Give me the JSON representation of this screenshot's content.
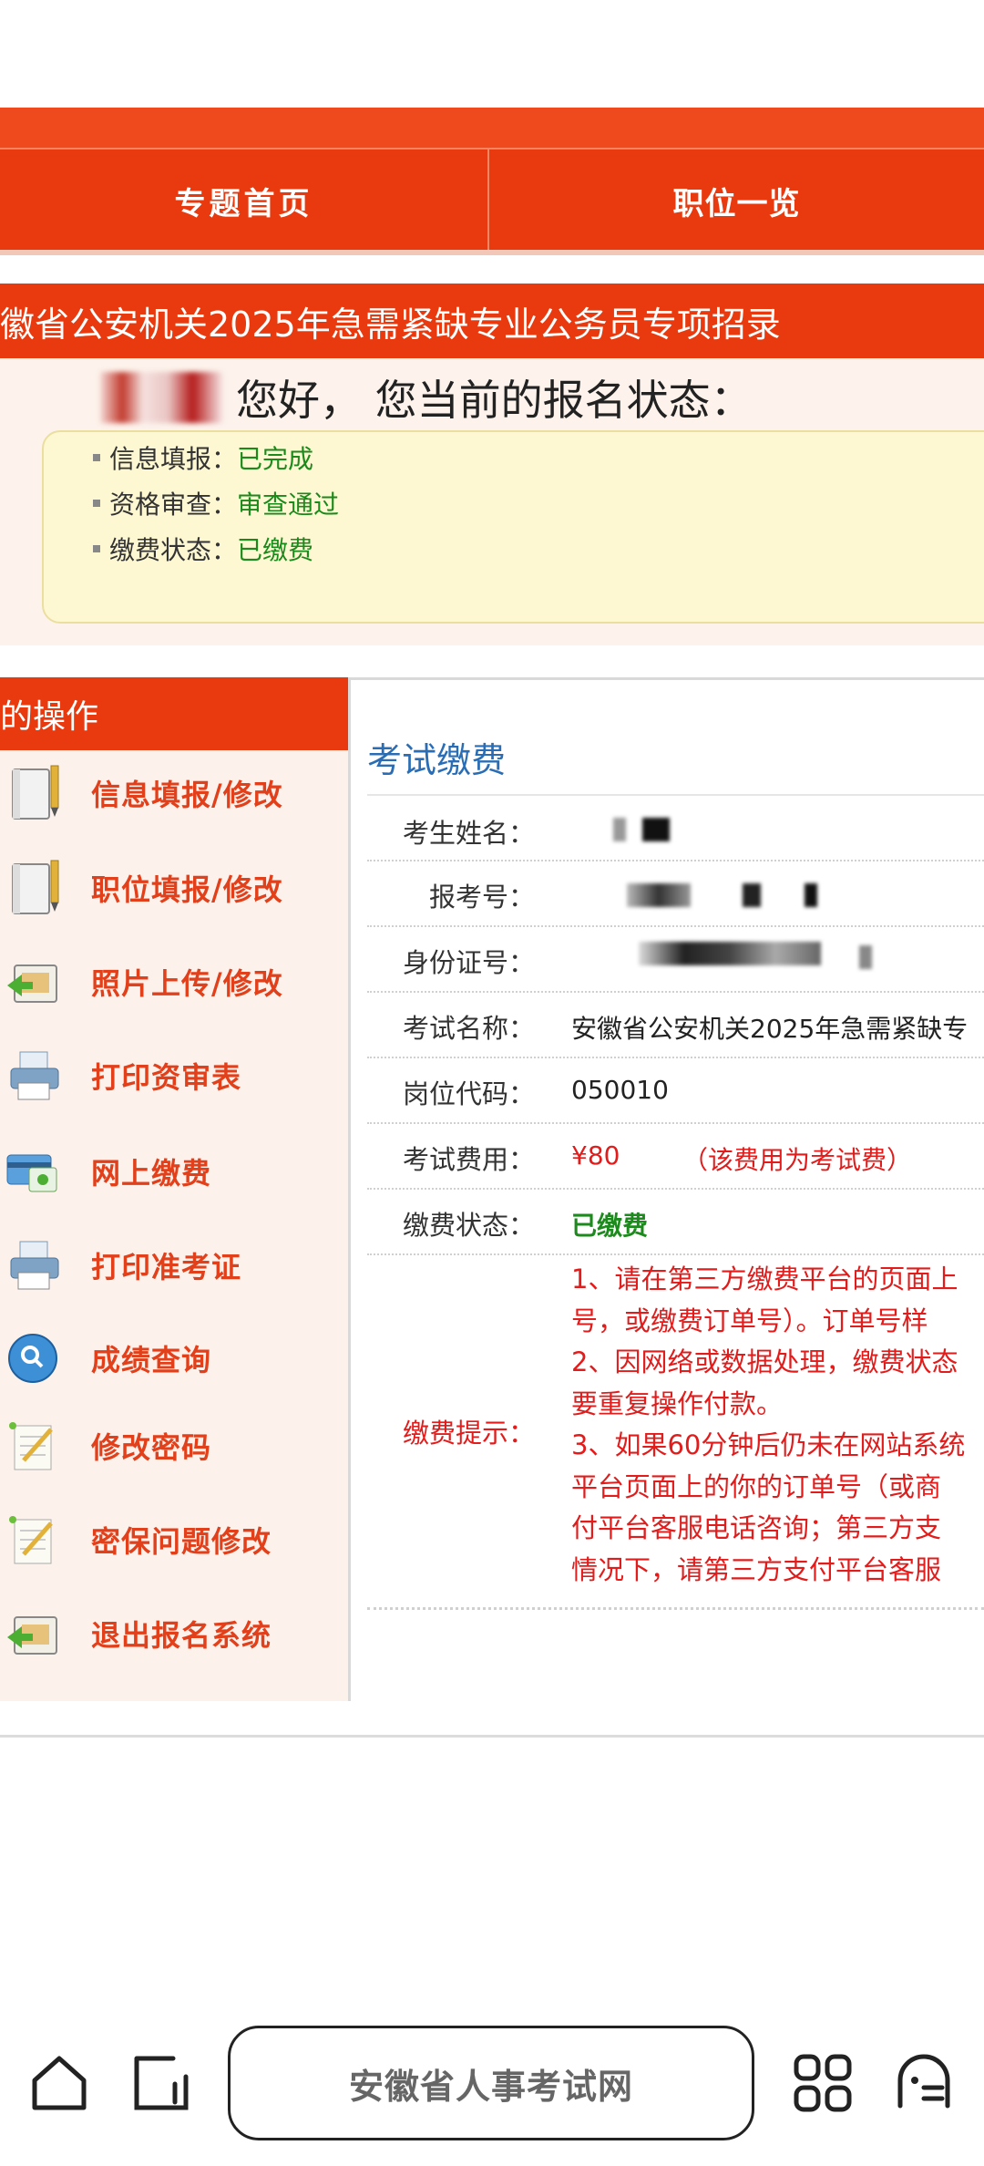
{
  "nav": {
    "home_label": "专题首页",
    "positions_label": "职位一览"
  },
  "banner": {
    "title": "徽省公安机关2025年急需紧缺专业公务员专项招录",
    "greeting": "您好， 您当前的报名状态："
  },
  "status": [
    {
      "label": "信息填报：",
      "value": "已完成"
    },
    {
      "label": "资格审查：",
      "value": "审查通过"
    },
    {
      "label": "缴费状态：",
      "value": "已缴费"
    }
  ],
  "sidebar": {
    "heading": "的操作",
    "items": [
      {
        "label": "信息填报/修改",
        "icon": "notebook-pencil-icon"
      },
      {
        "label": "职位填报/修改",
        "icon": "notebook-pencil-icon"
      },
      {
        "label": "照片上传/修改",
        "icon": "upload-arrow-icon"
      },
      {
        "label": "打印资审表",
        "icon": "printer-icon"
      },
      {
        "label": "网上缴费",
        "icon": "payment-card-icon"
      },
      {
        "label": "打印准考证",
        "icon": "printer-icon"
      },
      {
        "label": "成绩查询",
        "icon": "magnifier-icon"
      },
      {
        "label": "修改密码",
        "icon": "edit-note-icon"
      },
      {
        "label": "密保问题修改",
        "icon": "edit-note-icon"
      },
      {
        "label": "退出报名系统",
        "icon": "exit-arrow-icon"
      }
    ]
  },
  "content": {
    "title": "考试缴费",
    "fields": {
      "name_label": "考生姓名：",
      "regno_label": "报考号：",
      "id_label": "身份证号：",
      "exam_label": "考试名称：",
      "exam_value": "安徽省公安机关2025年急需紧缺专",
      "post_label": "岗位代码：",
      "post_value": "050010",
      "fee_label": "考试费用：",
      "fee_value": "¥80",
      "fee_note": "（该费用为考试费）",
      "paystatus_label": "缴费状态：",
      "paystatus_value": "已缴费",
      "tips_label": "缴费提示："
    },
    "tips": [
      "1、请在第三方缴费平台的页面上",
      "号，或缴费订单号）。订单号样",
      "2、因网络或数据处理，缴费状态",
      "要重复操作付款。",
      "3、如果60分钟后仍未在网站系统",
      "平台页面上的你的订单号（或商",
      "付平台客服电话咨询；第三方支",
      "情况下，请第三方支付平台客服"
    ]
  },
  "browser": {
    "address": "安徽省人事考试网",
    "icons": [
      "home-icon",
      "tabs-icon",
      "apps-grid-icon",
      "assistant-icon"
    ]
  },
  "colors": {
    "brand_red": "#e83a0e",
    "link_blue": "#2a6db5",
    "ok_green": "#1a8a1a",
    "alert_red": "#e21b1b"
  }
}
